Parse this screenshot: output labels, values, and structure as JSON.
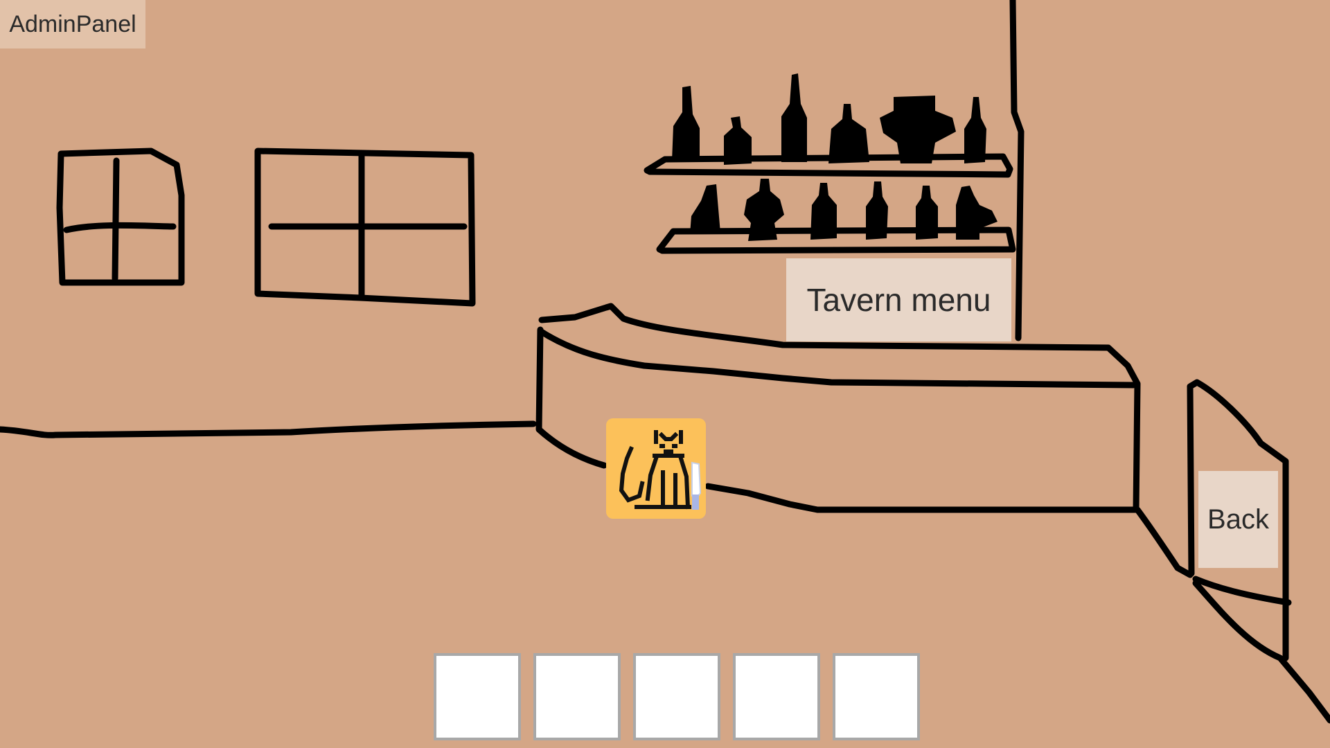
{
  "admin_panel": {
    "label": "AdminPanel"
  },
  "tavern": {
    "menu_label": "Tavern menu"
  },
  "navigation": {
    "back_label": "Back"
  },
  "player": {
    "avatar_icon": "cat-with-knife-icon"
  },
  "hotbar": {
    "slots": [
      "",
      "",
      "",
      "",
      ""
    ]
  },
  "colors": {
    "background": "#d4a686",
    "button": "#e8d6c8",
    "avatar_bg": "#fcc15a",
    "ink": "#000000"
  }
}
